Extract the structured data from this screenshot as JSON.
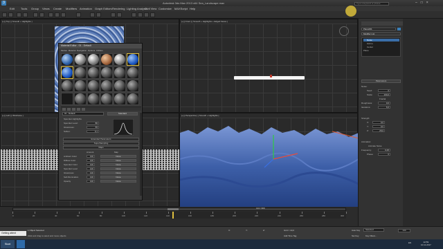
{
  "window": {
    "title": "Autodesk 3ds Max 2013 x64     Sea_Landscape.max"
  },
  "menu": [
    "Edit",
    "Tools",
    "Group",
    "Views",
    "Create",
    "Modifiers",
    "Animation",
    "Graph Editors",
    "Rendering",
    "Lighting Analysis",
    "Civil View",
    "Customize",
    "MAXScript",
    "Help"
  ],
  "search": {
    "placeholder": "Type a keyword or phrase"
  },
  "viewports": {
    "top": "[+] [ Top ] [ Smooth + Highlights ]",
    "front": "[+] [ Front ] [ Smooth + Highlights + Edged Faces ]",
    "left": "[+] [ Left ] [ Wireframe ]",
    "perspective": "[+] [ Perspective ] [ Smooth + Highlights ]"
  },
  "material_editor": {
    "title": "Material Editor - 01 - Default",
    "menu": [
      "Modes",
      "Material",
      "Navigation",
      "Options",
      "Utilities"
    ],
    "material_name": "01 - Default",
    "material_type": "Standard",
    "specular_highlights": "Specular Highlights",
    "specular_level_label": "Specular Level:",
    "specular_level": "80",
    "glossiness_label": "Glossiness:",
    "glossiness": "55",
    "soften_label": "Soften:",
    "soften": "0,1",
    "rollouts": [
      "Extended Parameters",
      "SuperSampling",
      "Maps"
    ],
    "maps_header": {
      "amount": "Amount",
      "map": "Map"
    },
    "maps": [
      {
        "name": "Ambient Color",
        "amount": "100",
        "map": "None"
      },
      {
        "name": "Diffuse Color",
        "amount": "100",
        "map": "None"
      },
      {
        "name": "Specular Color",
        "amount": "100",
        "map": "None"
      },
      {
        "name": "Specular Level",
        "amount": "100",
        "map": "None"
      },
      {
        "name": "Glossiness",
        "amount": "100",
        "map": "None"
      },
      {
        "name": "Self-Illumination",
        "amount": "100",
        "map": "None"
      },
      {
        "name": "Opacity",
        "amount": "100",
        "map": "None"
      }
    ]
  },
  "command_panel": {
    "object_name": "Plane001",
    "modifier_list": "Modifier List",
    "stack": [
      "Noise",
      "Gizmo",
      "Center",
      "Plane"
    ],
    "parameters_title": "Parameters",
    "noise_label": "Noise:",
    "seed_label": "Seed:",
    "seed": "0",
    "scale_label": "Scale:",
    "scale": "100,0",
    "fractal_label": "Fractal",
    "roughness_label": "Roughness:",
    "roughness": "0,0",
    "iterations_label": "Iterations:",
    "iterations": "6,0",
    "strength_label": "Strength:",
    "x_label": "X:",
    "x": "0,0",
    "y_label": "Y:",
    "y": "0,0",
    "z_label": "Z:",
    "z": "25,0",
    "animation_label": "Animation:",
    "animate_noise_label": "Animate Noise",
    "frequency_label": "Frequency:",
    "frequency": "0,25",
    "phase_label": "Phase:",
    "phase": "0"
  },
  "timeline": {
    "current": "144 / 300",
    "ticks": [
      "0",
      "20",
      "40",
      "60",
      "80",
      "100",
      "120",
      "140",
      "160",
      "180",
      "200",
      "220",
      "240",
      "260",
      "280",
      "300"
    ],
    "progress": 0.48
  },
  "status": {
    "selection": "1 Object Selected",
    "prompt": "Click and drag to select and move objects",
    "x": "X:",
    "y": "Y:",
    "z": "Z:",
    "grid": "Grid = 10,0",
    "auto_key": "Auto Key",
    "selected": "Selected",
    "set_key": "Set Key",
    "key_filters": "Key Filters...",
    "add_time_tag": "Add Time Tag",
    "frame": "144"
  },
  "chat": "Getting attent",
  "taskbar": {
    "start": "Start",
    "time": "22:59",
    "date": "10.11.2017",
    "lang": "EN"
  },
  "colors": {
    "ocean": "#3d5fa8",
    "accent": "#e0c040"
  }
}
